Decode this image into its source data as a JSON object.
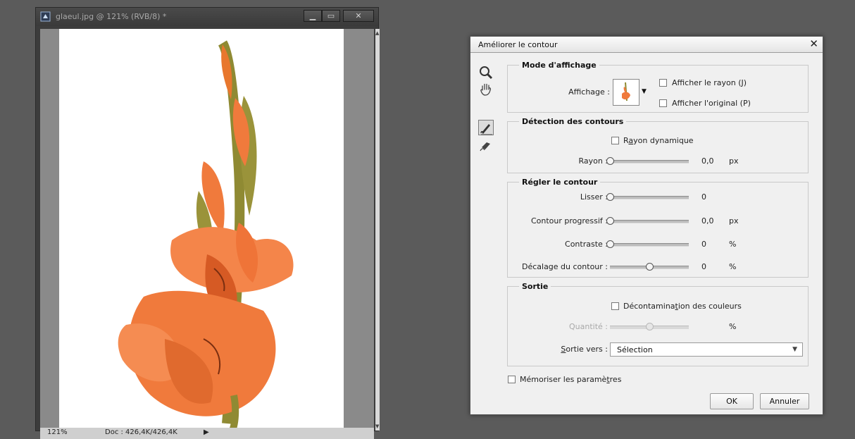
{
  "document": {
    "title": "glaeul.jpg @ 121% (RVB/8) *",
    "minimize_glyph": "▁",
    "maximize_glyph": "▭",
    "close_glyph": "✕",
    "status_zoom": "121%",
    "status_doc": "Doc : 426,4K/426,4K",
    "status_arrow": "▶"
  },
  "dialog": {
    "title": "Améliorer le contour",
    "close_glyph": "✕",
    "tools": [
      {
        "icon": "zoom-icon"
      },
      {
        "icon": "hand-icon"
      },
      {
        "icon": "refine-radius-brush-icon",
        "selected": true
      },
      {
        "icon": "erase-refinements-icon"
      }
    ],
    "view_mode": {
      "legend": "Mode d'affichage",
      "view_label": "Affichage :",
      "show_radius_label": "Afficher le rayon (J)",
      "show_radius_checked": false,
      "show_original_label": "Afficher l'original (P)",
      "show_original_checked": false
    },
    "edge_detection": {
      "legend": "Détection des contours",
      "smart_radius_pre": "R",
      "smart_radius_key": "a",
      "smart_radius_post": "yon dynamique",
      "smart_radius_checked": false,
      "radius_label": "Rayon :",
      "radius_value": "0,0",
      "radius_fraction": 0.0,
      "radius_unit": "px"
    },
    "adjust_edge": {
      "legend": "Régler le contour",
      "smooth_label": "Lisser :",
      "smooth_value": "0",
      "smooth_fraction": 0.0,
      "feather_label": "Contour progressif :",
      "feather_value": "0,0",
      "feather_fraction": 0.0,
      "feather_unit": "px",
      "contrast_label": "Contraste :",
      "contrast_value": "0",
      "contrast_fraction": 0.0,
      "contrast_unit": "%",
      "shift_label": "Décalage du contour :",
      "shift_value": "0",
      "shift_fraction": 0.5,
      "shift_unit": "%"
    },
    "output": {
      "legend": "Sortie",
      "decontaminate_pre": "Décontamina",
      "decontaminate_key": "t",
      "decontaminate_post": "ion des couleurs",
      "decontaminate_checked": false,
      "amount_label": "Quantité :",
      "amount_fraction": 0.5,
      "amount_unit": "%",
      "output_to_key": "S",
      "output_to_post": "ortie vers :",
      "output_to_value": "Sélection",
      "caret": "▼"
    },
    "remember_pre": "Mémoriser les paramè",
    "remember_key": "t",
    "remember_post": "res",
    "remember_checked": false,
    "ok_label": "OK",
    "cancel_label": "Annuler"
  },
  "colors": {
    "petal": "#f07a3c",
    "petal_dark": "#d65a24",
    "stem": "#8f8a33"
  }
}
